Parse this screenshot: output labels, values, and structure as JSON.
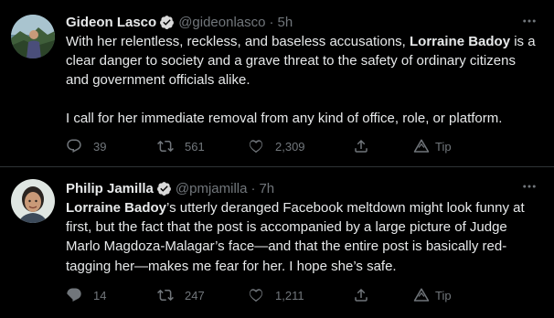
{
  "colors": {
    "background": "#000000",
    "text": "#e7e9ea",
    "muted": "#71767b",
    "verified_badge": "#d9d9d9",
    "divider": "#2f3336"
  },
  "tweets": [
    {
      "name": "Gideon Lasco",
      "handle": "@gideonlasco",
      "separator": "·",
      "time": "5h",
      "avatar_icon": "profile-photo",
      "text_parts": [
        "With her relentless, reckless, and baseless accusations, ",
        "Lorraine Badoy",
        " is a clear danger to society and a grave threat to the safety of ordinary citizens and government officials alike."
      ],
      "text_paragraph_2": "I call for her immediate removal from any kind of office, role, or platform.",
      "replies": "39",
      "retweets": "561",
      "likes": "2,309",
      "tip_label": "Tip"
    },
    {
      "name": "Philip Jamilla",
      "handle": "@pmjamilla",
      "separator": "·",
      "time": "7h",
      "avatar_icon": "profile-photo",
      "text_parts": [
        "Lorraine Badoy",
        "’s utterly deranged Facebook meltdown might look funny at first, but the fact that the post is accompanied by a large picture of Judge Marlo Magdoza-Malagar’s face—and that the entire post is basically red-tagging her—makes me fear for her. I hope she’s safe."
      ],
      "replies": "14",
      "retweets": "247",
      "likes": "1,211",
      "tip_label": "Tip"
    }
  ]
}
